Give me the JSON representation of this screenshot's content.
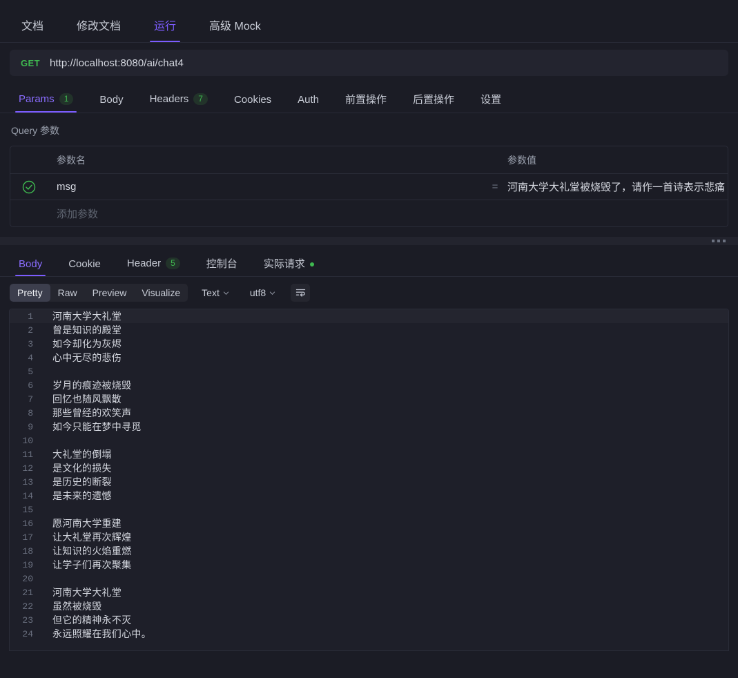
{
  "top_tabs": [
    {
      "label": "文档",
      "active": false
    },
    {
      "label": "修改文档",
      "active": false
    },
    {
      "label": "运行",
      "active": true
    },
    {
      "label": "高级 Mock",
      "active": false
    }
  ],
  "url_bar": {
    "method": "GET",
    "url": "http://localhost:8080/ai/chat4",
    "method_color": "#3fb950"
  },
  "request_tabs": [
    {
      "label": "Params",
      "badge": "1",
      "active": true
    },
    {
      "label": "Body",
      "badge": "",
      "active": false
    },
    {
      "label": "Headers",
      "badge": "7",
      "active": false
    },
    {
      "label": "Cookies",
      "badge": "",
      "active": false
    },
    {
      "label": "Auth",
      "badge": "",
      "active": false
    },
    {
      "label": "前置操作",
      "badge": "",
      "active": false
    },
    {
      "label": "后置操作",
      "badge": "",
      "active": false
    },
    {
      "label": "设置",
      "badge": "",
      "active": false
    }
  ],
  "params": {
    "section_title": "Query 参数",
    "col_name": "参数名",
    "col_value": "参数值",
    "equals": "=",
    "rows": [
      {
        "enabled": true,
        "name": "msg",
        "value": "河南大学大礼堂被烧毁了，请作一首诗表示悲痛"
      }
    ],
    "add_placeholder": "添加参数"
  },
  "response_tabs": [
    {
      "label": "Body",
      "badge": "",
      "dot": false,
      "active": true
    },
    {
      "label": "Cookie",
      "badge": "",
      "dot": false,
      "active": false
    },
    {
      "label": "Header",
      "badge": "5",
      "dot": false,
      "active": false
    },
    {
      "label": "控制台",
      "badge": "",
      "dot": false,
      "active": false
    },
    {
      "label": "实际请求",
      "badge": "",
      "dot": true,
      "active": false
    }
  ],
  "body_toolbar": {
    "views": [
      {
        "label": "Pretty",
        "active": true
      },
      {
        "label": "Raw",
        "active": false
      },
      {
        "label": "Preview",
        "active": false
      },
      {
        "label": "Visualize",
        "active": false
      }
    ],
    "format_select": "Text",
    "encoding_select": "utf8",
    "wrap_icon": "text-wrap-icon"
  },
  "response_body": {
    "language": "text",
    "lines": [
      {
        "n": 1,
        "text": "河南大学大礼堂"
      },
      {
        "n": 2,
        "text": "曾是知识的殿堂"
      },
      {
        "n": 3,
        "text": "如今却化为灰烬"
      },
      {
        "n": 4,
        "text": "心中无尽的悲伤"
      },
      {
        "n": 5,
        "text": ""
      },
      {
        "n": 6,
        "text": "岁月的痕迹被烧毁"
      },
      {
        "n": 7,
        "text": "回忆也随风飘散"
      },
      {
        "n": 8,
        "text": "那些曾经的欢笑声"
      },
      {
        "n": 9,
        "text": "如今只能在梦中寻觅"
      },
      {
        "n": 10,
        "text": ""
      },
      {
        "n": 11,
        "text": "大礼堂的倒塌"
      },
      {
        "n": 12,
        "text": "是文化的损失"
      },
      {
        "n": 13,
        "text": "是历史的断裂"
      },
      {
        "n": 14,
        "text": "是未来的遗憾"
      },
      {
        "n": 15,
        "text": ""
      },
      {
        "n": 16,
        "text": "愿河南大学重建"
      },
      {
        "n": 17,
        "text": "让大礼堂再次辉煌"
      },
      {
        "n": 18,
        "text": "让知识的火焰重燃"
      },
      {
        "n": 19,
        "text": "让学子们再次聚集"
      },
      {
        "n": 20,
        "text": ""
      },
      {
        "n": 21,
        "text": "河南大学大礼堂"
      },
      {
        "n": 22,
        "text": "虽然被烧毁"
      },
      {
        "n": 23,
        "text": "但它的精神永不灭"
      },
      {
        "n": 24,
        "text": "永远照耀在我们心中。"
      }
    ],
    "highlight_line": 1
  },
  "colors": {
    "accent": "#7c5cff",
    "success": "#3fb950",
    "background": "#1b1c25",
    "panel": "#1e1f29",
    "border": "#2a2c38",
    "text": "#d5d8e0",
    "muted": "#9aa0ad"
  }
}
